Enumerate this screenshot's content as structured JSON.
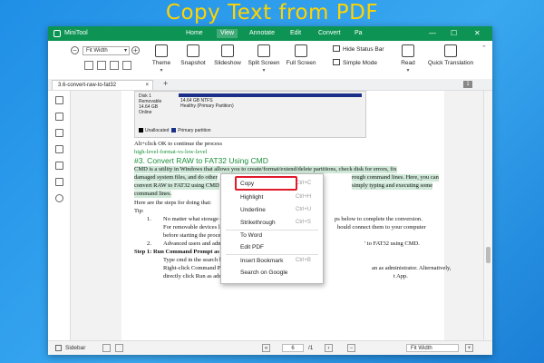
{
  "banner": "Copy Text from PDF",
  "titlebar": {
    "app_name": "MiniTool",
    "menus": [
      "Home",
      "View",
      "Annotate",
      "Edit",
      "Convert",
      "Pa"
    ],
    "active_menu": "View",
    "controls": [
      "—",
      "☐",
      "✕"
    ]
  },
  "ribbon": {
    "zoom_out": "−",
    "zoom_in": "+",
    "zoom_value": "Fit Width",
    "buttons": [
      "Theme",
      "Snapshot",
      "Slideshow",
      "Split Screen",
      "Full Screen"
    ],
    "hide_status_bar": "Hide Status Bar",
    "simple_mode": "Simple Mode",
    "read": "Read",
    "quick_translation": "Quick Translation"
  },
  "tabs": {
    "file_tab": "3.6-convert-raw-to-fat32",
    "close": "×",
    "add": "+"
  },
  "document": {
    "disk": {
      "name": "Disk 1",
      "type": "Removable",
      "size": "14.64 GB",
      "status": "Online",
      "part_size": "14.64 GB NTFS",
      "part_status": "Healthy (Primary Partition)",
      "legend_unallocated": "Unallocated",
      "legend_primary": "Primary partition"
    },
    "lines": [
      "Alt+click OK to continue the process",
      "high-level-format-vs-low-level",
      "#3. Convert RAW to FAT32 Using CMD",
      "CMD is a utility in Windows that allows you to create/format/extend/delete partitions, check disk for errors, fix",
      "damaged system files, and do other",
      "rough command lines. Here, you can",
      "convert RAW to FAT32 using CMD",
      "simply typing and executing some",
      "command lines.",
      "Here are the steps for doing that:",
      "Tip:",
      "1.",
      "No matter what storage devi",
      "ps below to complete the conversion.",
      "For removable devices like t",
      "hould connect them to your computer",
      "before starting the process.",
      "2.",
      "Advanced users and adminis",
      "' to FAT32 using CMD.",
      "Step 1: Run Command Prompt as",
      "Type cmd in the search box",
      "Right-click Command Pro",
      "an as administrator. Alternatively,",
      "directly click Run as admin",
      "t App."
    ]
  },
  "context_menu": [
    {
      "label": "Copy",
      "shortcut": "Ctrl+C"
    },
    {
      "label": "Highlight",
      "shortcut": "Ctrl+H"
    },
    {
      "label": "Underline",
      "shortcut": "Ctrl+U"
    },
    {
      "label": "Strikethrough",
      "shortcut": "Ctrl+S"
    },
    {
      "label": "To Word",
      "shortcut": ""
    },
    {
      "label": "Edit PDF",
      "shortcut": ""
    },
    {
      "label": "Insert Bookmark",
      "shortcut": "Ctrl+B"
    },
    {
      "label": "Search on Google",
      "shortcut": ""
    }
  ],
  "statusbar": {
    "sidebar_label": "Sidebar",
    "page_current": "6",
    "page_total": "/1",
    "fit": "Fit Width"
  },
  "colors": {
    "accent": "#0d9454",
    "highlight_box": "#e0192b",
    "banner_text": "#ffd400"
  }
}
